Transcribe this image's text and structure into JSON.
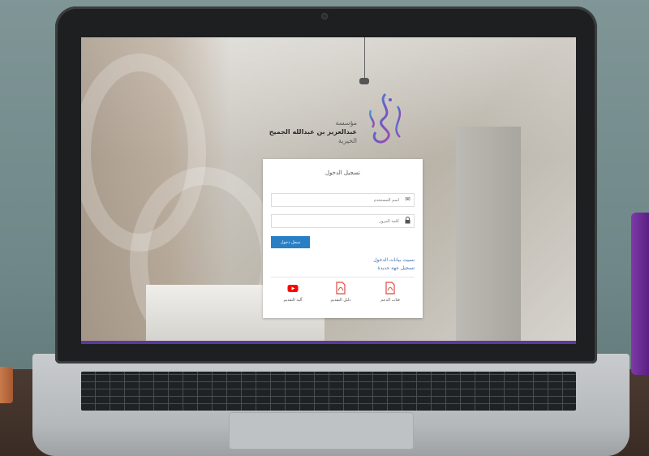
{
  "login": {
    "title": "تسجيل الدخول",
    "username_placeholder": "اسم المستخدم",
    "password_placeholder": "كلمة المرور",
    "submit_label": "سجل دخول",
    "forgot_link": "نسيت بيانات الدخول",
    "register_link": "تسجيل جهة جديدة"
  },
  "logo": {
    "line1": "مؤسسة",
    "line2": "عبدالعزيز بن عبدالله الجميح",
    "line3": "الخيرية"
  },
  "actions": [
    {
      "label": "فئات الدعم",
      "icon": "pdf-icon"
    },
    {
      "label": "دليل التقديم",
      "icon": "pdf-icon"
    },
    {
      "label": "آلية التقديم",
      "icon": "youtube-icon"
    }
  ],
  "colors": {
    "accent_blue": "#2a7fc4",
    "link_blue": "#3a6fb0",
    "pdf_red": "#e04a3f",
    "youtube_red": "#ff0000",
    "screen_border_purple": "#5b3aa0"
  }
}
